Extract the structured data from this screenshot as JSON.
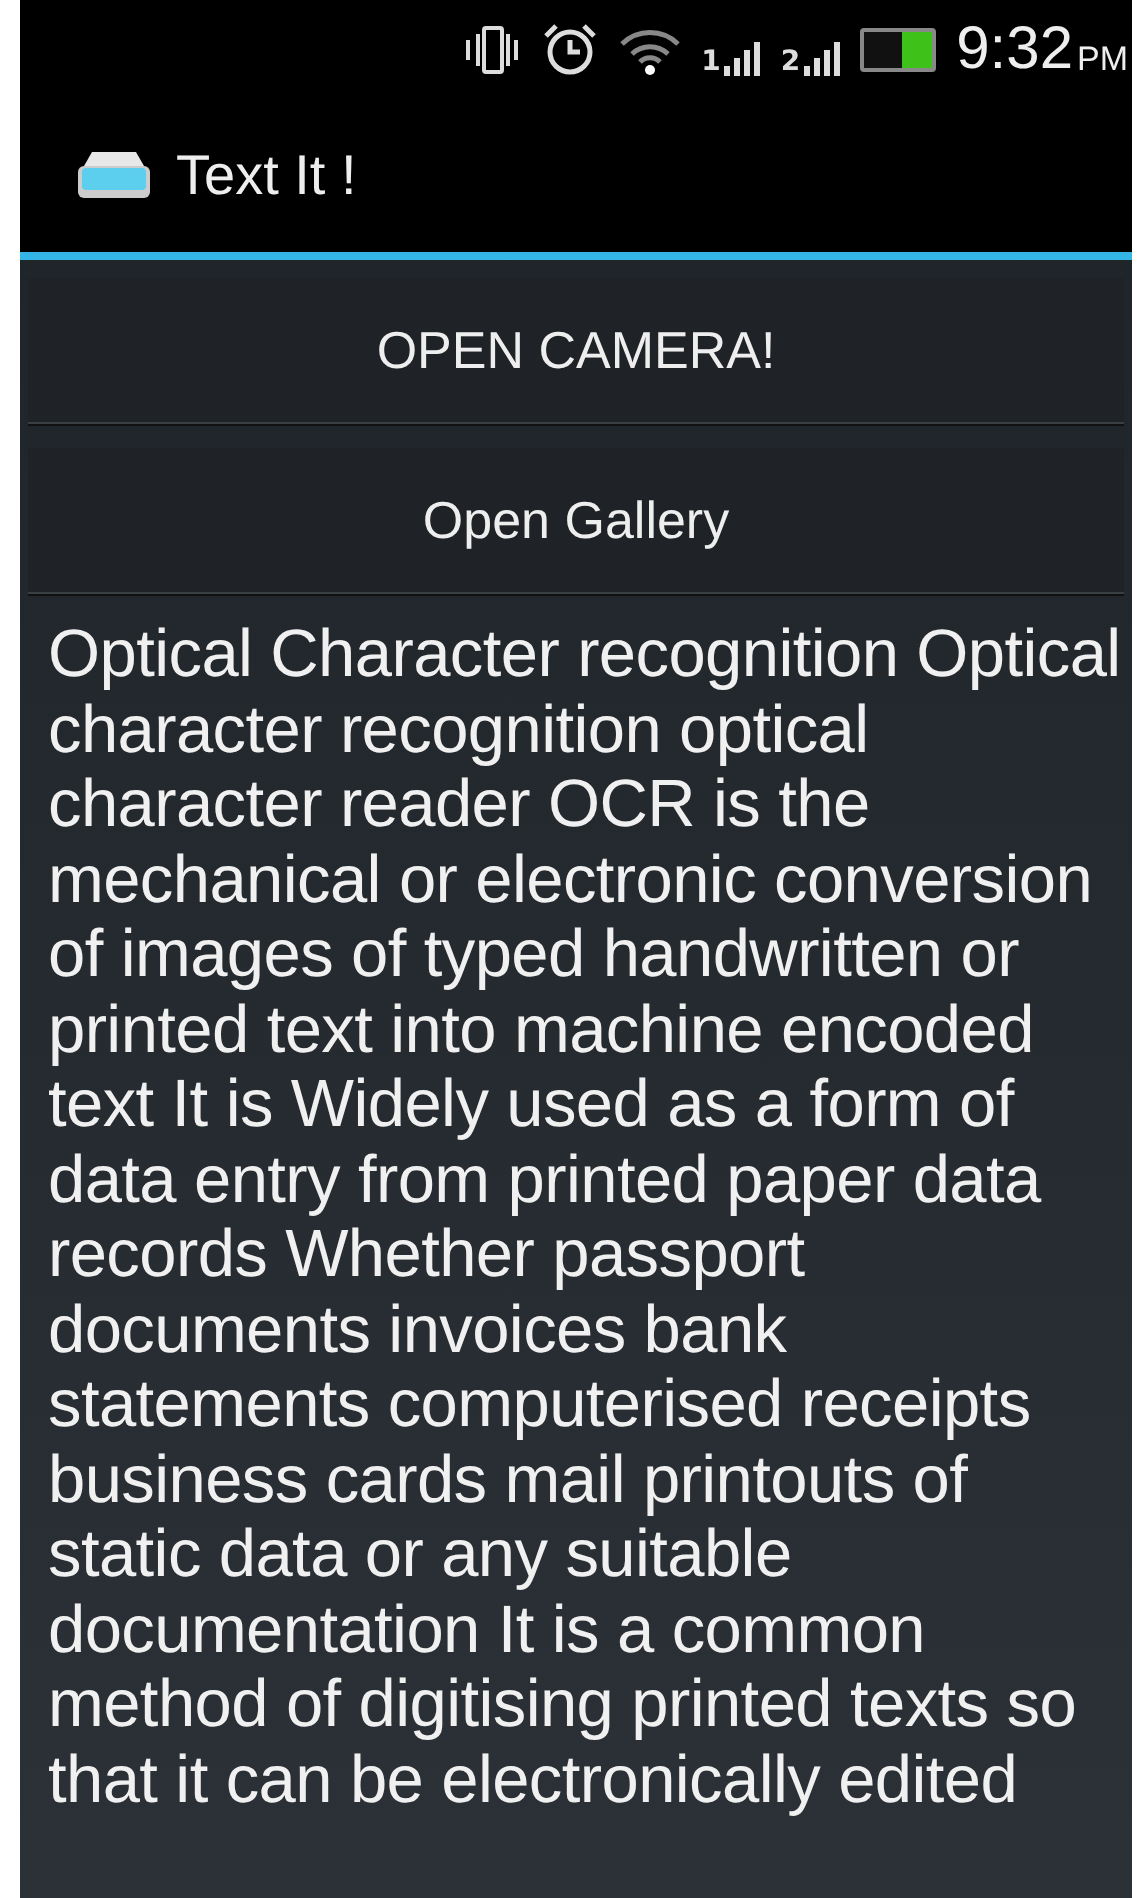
{
  "status_bar": {
    "sim_1": "1",
    "sim_2": "2",
    "time": "9:32",
    "period": "PM"
  },
  "action_bar": {
    "title": "Text It !"
  },
  "buttons": [
    "OPEN CAMERA!",
    "Open Gallery"
  ],
  "result_text": {
    "lines": [
      "Optical Character recognition Optical",
      "character recognition optical",
      "character reader OCR is the",
      "mechanical or electronic conversion",
      "of images of typed handwritten or",
      "printed text into machine encoded",
      "text It is Widely used as a form of",
      "data entry from printed paper data",
      "records Whether passport",
      "documents invoices bank",
      "statements computerised receipts",
      "business cards mail printouts of",
      "static data or any suitable",
      "documentation It is a common",
      "method of digitising printed texts so",
      "that it can be electronically edited"
    ]
  }
}
